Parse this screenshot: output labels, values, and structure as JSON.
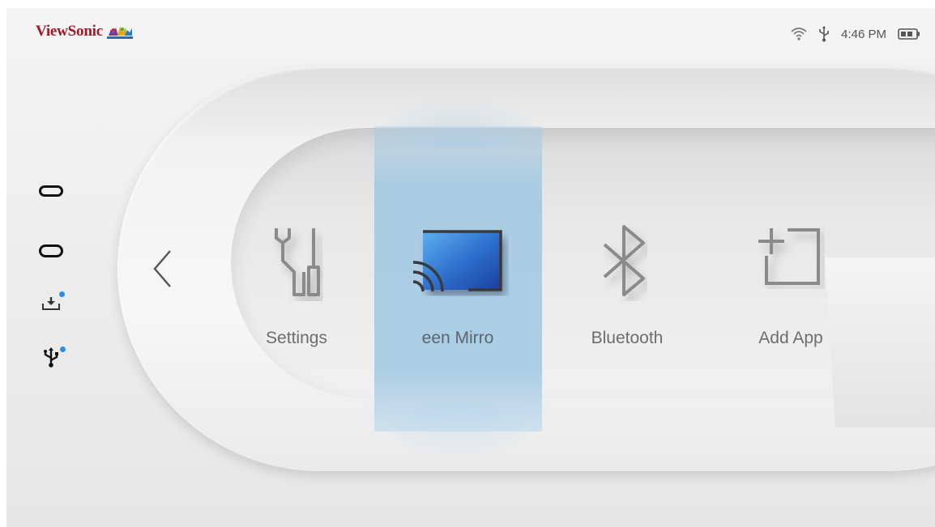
{
  "brand": {
    "name": "ViewSonic"
  },
  "status_bar": {
    "time": "4:46 PM",
    "icons": [
      "wifi-icon",
      "usb-icon",
      "battery-icon"
    ]
  },
  "sources": [
    {
      "name": "hdmi",
      "icon": "hdmi-port-icon",
      "connected": false
    },
    {
      "name": "usb-c",
      "icon": "usb-c-port-icon",
      "connected": false
    },
    {
      "name": "download",
      "icon": "download-tray-icon",
      "connected": true
    },
    {
      "name": "usb",
      "icon": "usb-icon",
      "connected": true
    }
  ],
  "apps": [
    {
      "label": "Settings",
      "icon": "settings-tools-icon",
      "selected": false
    },
    {
      "label": "een Mirro",
      "icon": "screen-mirroring-icon",
      "selected": true
    },
    {
      "label": "Bluetooth",
      "icon": "bluetooth-icon",
      "selected": false
    },
    {
      "label": "Add App",
      "icon": "add-app-icon",
      "selected": false
    }
  ],
  "colors": {
    "brand_red": "#a01a28",
    "selection_blue": "#96c3e1",
    "indicator_dot": "#2c8fde",
    "mirror_icon_blue": "#2f72cf"
  }
}
